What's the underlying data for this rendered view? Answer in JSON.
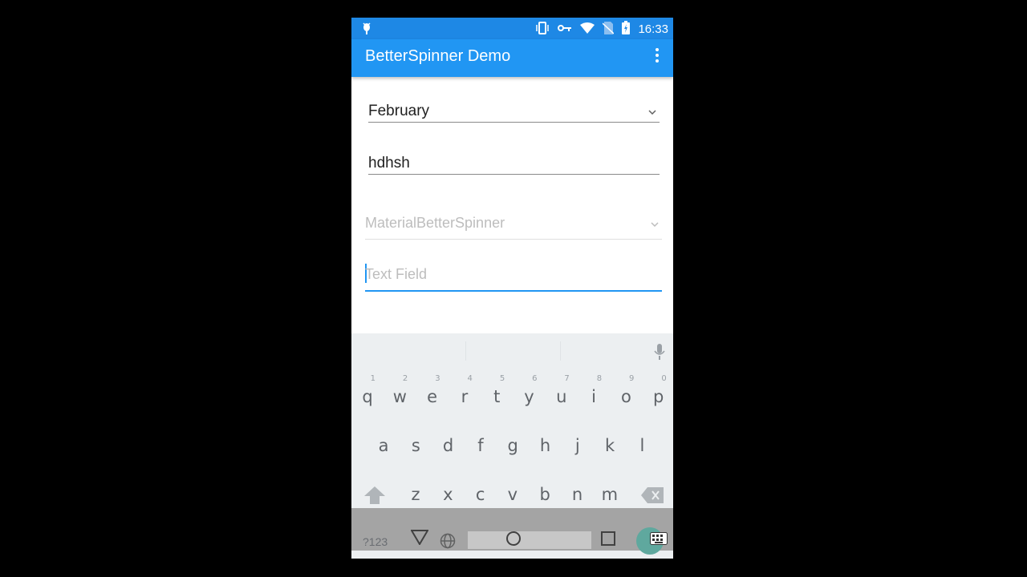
{
  "status": {
    "time": "16:33"
  },
  "appbar": {
    "title": "BetterSpinner Demo"
  },
  "fields": {
    "spinner1_value": "February",
    "text1_value": "hdhsh",
    "material_spinner_hint": "MaterialBetterSpinner",
    "text_field_hint": "Text Field"
  },
  "keyboard": {
    "row1": [
      {
        "c": "q",
        "n": "1"
      },
      {
        "c": "w",
        "n": "2"
      },
      {
        "c": "e",
        "n": "3"
      },
      {
        "c": "r",
        "n": "4"
      },
      {
        "c": "t",
        "n": "5"
      },
      {
        "c": "y",
        "n": "6"
      },
      {
        "c": "u",
        "n": "7"
      },
      {
        "c": "i",
        "n": "8"
      },
      {
        "c": "o",
        "n": "9"
      },
      {
        "c": "p",
        "n": "0"
      }
    ],
    "row2": [
      "a",
      "s",
      "d",
      "f",
      "g",
      "h",
      "j",
      "k",
      "l"
    ],
    "row3": [
      "z",
      "x",
      "c",
      "v",
      "b",
      "n",
      "m"
    ],
    "symbols_label": "?123"
  },
  "icons": [
    "bug-icon",
    "vibrate-icon",
    "key-icon",
    "wifi-icon",
    "no-sim-icon",
    "battery-icon",
    "overflow-menu-icon",
    "chevron-down-icon",
    "mic-icon",
    "shift-icon",
    "backspace-icon",
    "globe-icon",
    "back-icon",
    "home-icon",
    "recents-icon",
    "keyboard-icon"
  ]
}
